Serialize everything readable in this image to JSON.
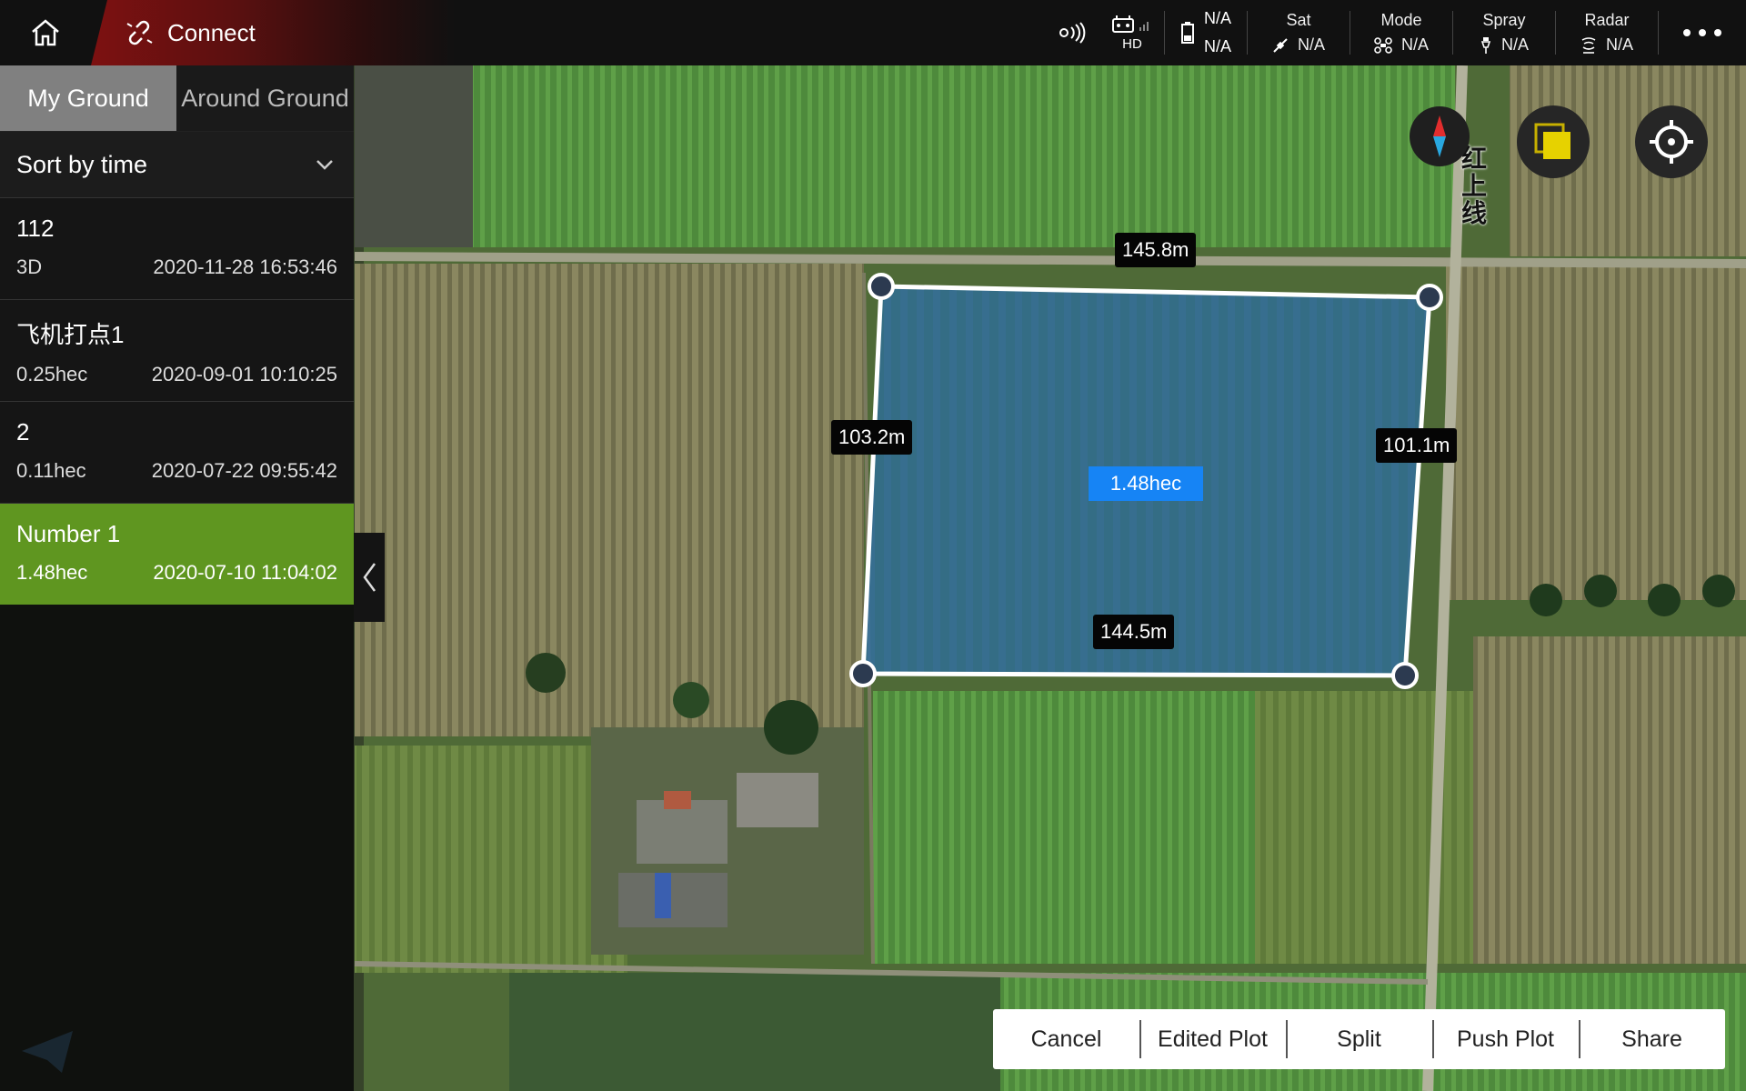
{
  "app": {
    "connect_label": "Connect",
    "icons": {
      "home": "home-icon",
      "connect": "broken-link-icon",
      "more": "more-dots-icon"
    }
  },
  "status": {
    "rc": {
      "label": "HD"
    },
    "battery": {
      "value1": "N/A",
      "value2": "N/A"
    },
    "items": [
      {
        "title": "Sat",
        "value": "N/A",
        "icon": "satellite-icon"
      },
      {
        "title": "Mode",
        "value": "N/A",
        "icon": "drone-icon"
      },
      {
        "title": "Spray",
        "value": "N/A",
        "icon": "spray-icon"
      },
      {
        "title": "Radar",
        "value": "N/A",
        "icon": "radar-icon"
      }
    ]
  },
  "sidebar": {
    "tabs": [
      {
        "label": "My Ground",
        "active": true
      },
      {
        "label": "Around Ground",
        "active": false
      }
    ],
    "sort_label": "Sort by time",
    "plots": [
      {
        "name": "112",
        "size": "3D",
        "date": "2020-11-28 16:53:46",
        "selected": false
      },
      {
        "name": "飞机打点1",
        "size": "0.25hec",
        "date": "2020-09-01 10:10:25",
        "selected": false
      },
      {
        "name": "2",
        "size": "0.11hec",
        "date": "2020-07-22 09:55:42",
        "selected": false
      },
      {
        "name": "Number 1",
        "size": "1.48hec",
        "date": "2020-07-10 11:04:02",
        "selected": true
      }
    ]
  },
  "map": {
    "road_label": "红上线",
    "plot": {
      "area": "1.48hec",
      "edges": {
        "top": "145.8m",
        "left": "103.2m",
        "right": "101.1m",
        "bottom": "144.5m"
      }
    },
    "colors": {
      "plot_fill": "#2e6ea3",
      "selected_item": "#5f9620",
      "area_badge": "#1684f5"
    }
  },
  "actions": {
    "cancel": "Cancel",
    "edited_plot": "Edited Plot",
    "split": "Split",
    "push_plot": "Push Plot",
    "share": "Share"
  }
}
